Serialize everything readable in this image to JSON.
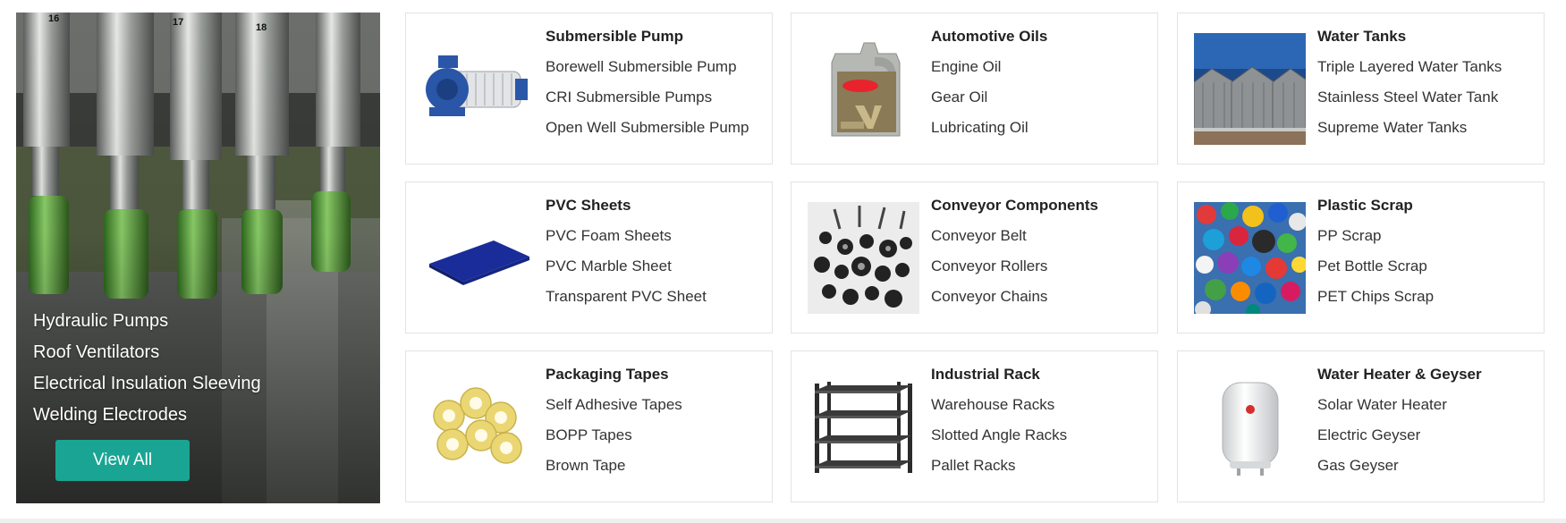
{
  "hero": {
    "links": [
      "Hydraulic Pumps",
      "Roof Ventilators",
      "Electrical Insulation Sleeving",
      "Welding Electrodes"
    ],
    "button_label": "View All",
    "machine_numbers": [
      "16",
      "17",
      "18"
    ]
  },
  "categories": [
    {
      "title": "Submersible Pump",
      "image_icon": "blue-pump-icon",
      "items": [
        "Borewell Submersible Pump",
        "CRI Submersible Pumps",
        "Open Well Submersible Pump"
      ]
    },
    {
      "title": "Automotive Oils",
      "image_icon": "oil-can-icon",
      "items": [
        "Engine Oil",
        "Gear Oil",
        "Lubricating Oil"
      ]
    },
    {
      "title": "Water Tanks",
      "image_icon": "steel-tanks-icon",
      "items": [
        "Triple Layered Water Tanks",
        "Stainless Steel Water Tank",
        "Supreme Water Tanks"
      ]
    },
    {
      "title": "PVC Sheets",
      "image_icon": "blue-sheet-icon",
      "items": [
        "PVC Foam Sheets",
        "PVC Marble Sheet",
        "Transparent PVC Sheet"
      ]
    },
    {
      "title": "Conveyor Components",
      "image_icon": "conveyor-parts-icon",
      "items": [
        "Conveyor Belt",
        "Conveyor Rollers",
        "Conveyor Chains"
      ]
    },
    {
      "title": "Plastic Scrap",
      "image_icon": "plastic-caps-icon",
      "items": [
        "PP Scrap",
        "Pet Bottle Scrap",
        "PET Chips Scrap"
      ]
    },
    {
      "title": "Packaging Tapes",
      "image_icon": "tape-rolls-icon",
      "items": [
        "Self Adhesive Tapes",
        "BOPP Tapes",
        "Brown Tape"
      ]
    },
    {
      "title": "Industrial Rack",
      "image_icon": "metal-rack-icon",
      "items": [
        "Warehouse Racks",
        "Slotted Angle Racks",
        "Pallet Racks"
      ]
    },
    {
      "title": "Water Heater & Geyser",
      "image_icon": "water-heater-icon",
      "items": [
        "Solar Water Heater",
        "Electric Geyser",
        "Gas Geyser"
      ]
    }
  ],
  "colors": {
    "button": "#1aa493",
    "card_border": "#e3e3e3",
    "title": "#222222",
    "text": "#333333"
  }
}
